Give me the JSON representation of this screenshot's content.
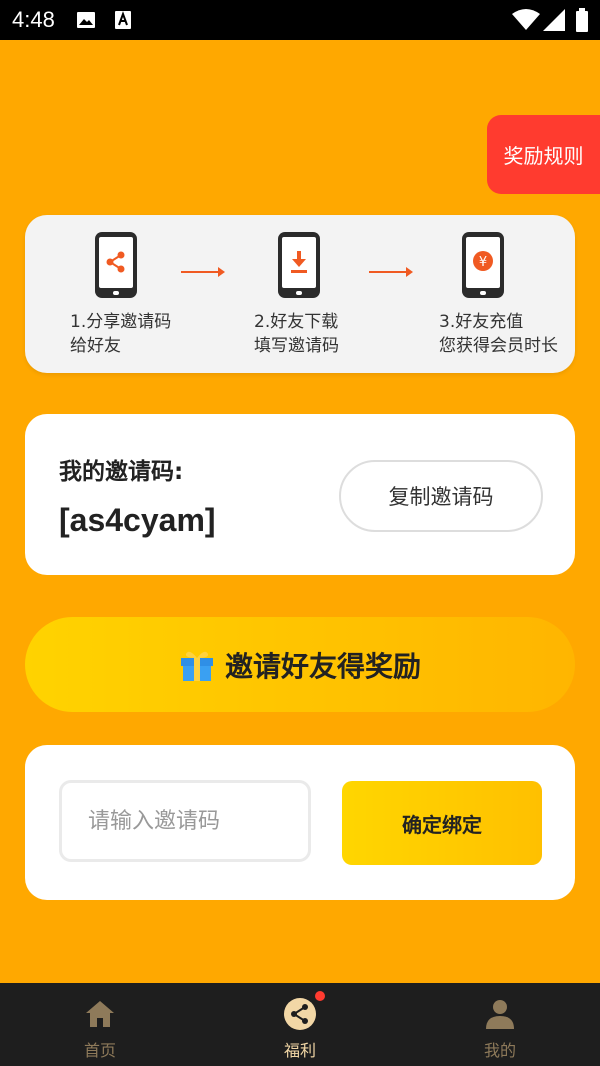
{
  "status_bar": {
    "time": "4:48"
  },
  "rules_button": {
    "label": "奖励规则"
  },
  "steps": [
    {
      "label_line1": "1.分享邀请码",
      "label_line2": "给好友",
      "icon": "share-icon"
    },
    {
      "label_line1": "2.好友下载",
      "label_line2": "填写邀请码",
      "icon": "download-icon"
    },
    {
      "label_line1": "3.好友充值",
      "label_line2": "您获得会员时长",
      "icon": "yuan-coin-icon",
      "coin_symbol": "¥"
    }
  ],
  "invite_code": {
    "label": "我的邀请码:",
    "value": "[as4cyam]",
    "copy_label": "复制邀请码"
  },
  "invite_banner": {
    "label": "邀请好友得奖励"
  },
  "bind": {
    "placeholder": "请输入邀请码",
    "value": "",
    "button_label": "确定绑定"
  },
  "tabbar": {
    "items": [
      {
        "label": "首页",
        "icon": "home-icon"
      },
      {
        "label": "福利",
        "icon": "share-icon",
        "active": true
      },
      {
        "label": "我的",
        "icon": "user-icon"
      }
    ]
  },
  "colors": {
    "background": "#FFA800",
    "rules_button": "#FF3B2F",
    "arrow": "#F05A22",
    "tab_active": "#F2D7A6",
    "tab_inactive": "#8E7A5A"
  }
}
